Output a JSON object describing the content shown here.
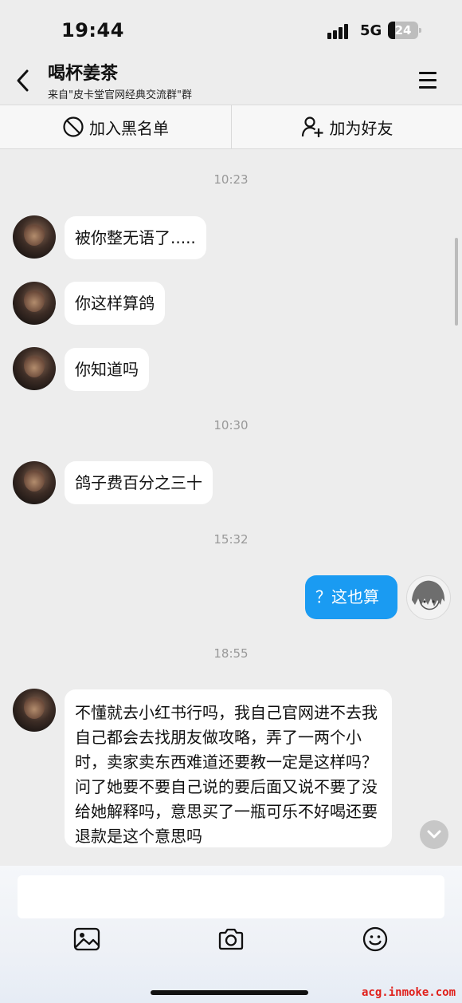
{
  "status_bar": {
    "time": "19:44",
    "network": "5G",
    "battery": "24",
    "battery_level": 0.24
  },
  "header": {
    "title": "喝杯姜茶",
    "subtitle": "来自\"皮卡堂官网经典交流群\"群"
  },
  "actions": {
    "blacklist_label": "加入黑名单",
    "add_friend_label": "加为好友"
  },
  "messages": [
    {
      "type": "time",
      "text": "10:23"
    },
    {
      "type": "msg",
      "side": "left",
      "text": "被你整无语了....."
    },
    {
      "type": "msg",
      "side": "left",
      "text": "你这样算鸽"
    },
    {
      "type": "msg",
      "side": "left",
      "text": "你知道吗"
    },
    {
      "type": "time",
      "text": "10:30"
    },
    {
      "type": "msg",
      "side": "left",
      "text": "鸽子费百分之三十"
    },
    {
      "type": "time",
      "text": "15:32"
    },
    {
      "type": "msg",
      "side": "right",
      "text": "？这也算"
    },
    {
      "type": "time",
      "text": "18:55"
    },
    {
      "type": "msg",
      "side": "left",
      "text": "不懂就去小红书行吗，我自己官网进不去我自己都会去找朋友做攻略，弄了一两个小时，卖家卖东西难道还要教一定是这样吗？问了她要不要自己说的要后面又说不要了没给她解释吗，意思买了一瓶可乐不好喝还要退款是这个意思吗"
    }
  ],
  "input": {
    "placeholder": ""
  },
  "toolbar": {
    "icons": [
      "image-icon",
      "camera-icon",
      "emoji-icon"
    ]
  },
  "colors": {
    "accent": "#1a9bf2",
    "background": "#ededed",
    "bubble": "#ffffff"
  },
  "watermark": "acg.inmoke.com"
}
